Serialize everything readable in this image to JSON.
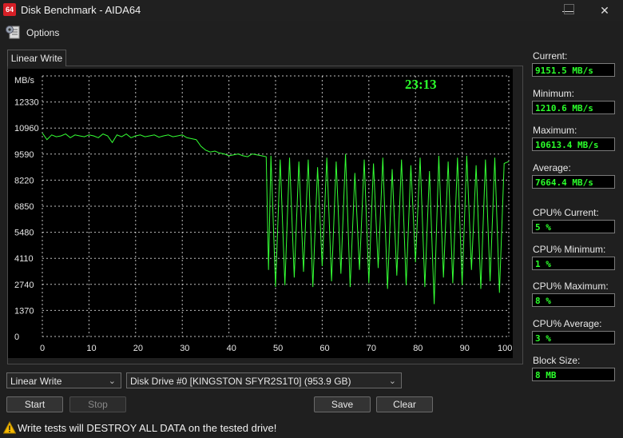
{
  "window": {
    "app_icon_text": "64",
    "title": "Disk Benchmark - AIDA64",
    "minimize": "—",
    "maximize": "☐",
    "close": "✕"
  },
  "menu": {
    "options_label": "Options"
  },
  "tab": {
    "label": "Linear Write"
  },
  "colors": {
    "trace": "#34ff34",
    "grid": "#ffffff",
    "plot_bg": "#000000",
    "value_text": "#2bff2b"
  },
  "chart_data": {
    "type": "line",
    "ylabel": "MB/s",
    "time_label": "23:13",
    "y_ticks": [
      "0",
      "1370",
      "2740",
      "4110",
      "5480",
      "6850",
      "8220",
      "9590",
      "10960",
      "12330"
    ],
    "x_ticks": [
      "0",
      "10",
      "20",
      "30",
      "40",
      "50",
      "60",
      "70",
      "80",
      "90",
      "100 %"
    ],
    "ylim": [
      0,
      13700
    ],
    "xlim": [
      0,
      100
    ],
    "grid": true,
    "series": [
      {
        "x": [
          0,
          1,
          2,
          3,
          4,
          5,
          6,
          7,
          8,
          9,
          10,
          11,
          12,
          13,
          14,
          15,
          16,
          17,
          18,
          19,
          20,
          21,
          22,
          23,
          24,
          25,
          26,
          27,
          28,
          29,
          30,
          31,
          32,
          33,
          34,
          35,
          36,
          37,
          38,
          39,
          40,
          41,
          42,
          43,
          44,
          45,
          46,
          47,
          48,
          48.5,
          49,
          50,
          51,
          52,
          53,
          54,
          55,
          56,
          57,
          58,
          59,
          60,
          61,
          62,
          63,
          64,
          65,
          66,
          67,
          68,
          69,
          70,
          71,
          72,
          73,
          74,
          75,
          76,
          77,
          78,
          79,
          80,
          81,
          82,
          83,
          84,
          85,
          86,
          87,
          88,
          89,
          90,
          91,
          92,
          93,
          94,
          95,
          96,
          97,
          98,
          99,
          100
        ],
        "y": [
          10700,
          10350,
          10600,
          10500,
          10550,
          10650,
          10450,
          10600,
          10550,
          10500,
          10600,
          10550,
          10450,
          10650,
          10550,
          10200,
          10600,
          10500,
          10650,
          10450,
          10550,
          10600,
          10500,
          10550,
          10600,
          10480,
          10550,
          10600,
          10500,
          10550,
          10600,
          10450,
          10400,
          10350,
          10000,
          9800,
          9700,
          9750,
          9650,
          9600,
          9500,
          9550,
          9600,
          9500,
          9450,
          9600,
          9550,
          9500,
          9450,
          3500,
          9500,
          2600,
          9300,
          2700,
          9400,
          3100,
          9200,
          3400,
          9300,
          2600,
          8900,
          3700,
          9400,
          2900,
          9200,
          3300,
          9600,
          2600,
          8600,
          3500,
          9300,
          2800,
          9100,
          3600,
          9400,
          2500,
          8800,
          3200,
          9300,
          2700,
          9000,
          3900,
          9400,
          2600,
          8700,
          1700,
          9500,
          3100,
          9200,
          2800,
          9400,
          2700,
          9500,
          3500,
          9000,
          2500,
          9300,
          2900,
          9400,
          2300,
          9100,
          9200
        ]
      }
    ]
  },
  "stats": [
    {
      "label": "Current:",
      "value": "9151.5 MB/s"
    },
    {
      "label": "Minimum:",
      "value": "1210.6 MB/s"
    },
    {
      "label": "Maximum:",
      "value": "10613.4 MB/s"
    },
    {
      "label": "Average:",
      "value": "7664.4 MB/s"
    },
    {
      "label": "CPU% Current:",
      "value": "5 %"
    },
    {
      "label": "CPU% Minimum:",
      "value": "1 %"
    },
    {
      "label": "CPU% Maximum:",
      "value": "8 %"
    },
    {
      "label": "CPU% Average:",
      "value": "3 %"
    },
    {
      "label": "Block Size:",
      "value": "8 MB"
    }
  ],
  "controls": {
    "test_select": "Linear Write",
    "drive_select": "Disk Drive #0  [KINGSTON SFYR2S1T0]  (953.9 GB)",
    "start": "Start",
    "stop": "Stop",
    "save": "Save",
    "clear": "Clear"
  },
  "warning": "Write tests will DESTROY ALL DATA on the tested drive!"
}
